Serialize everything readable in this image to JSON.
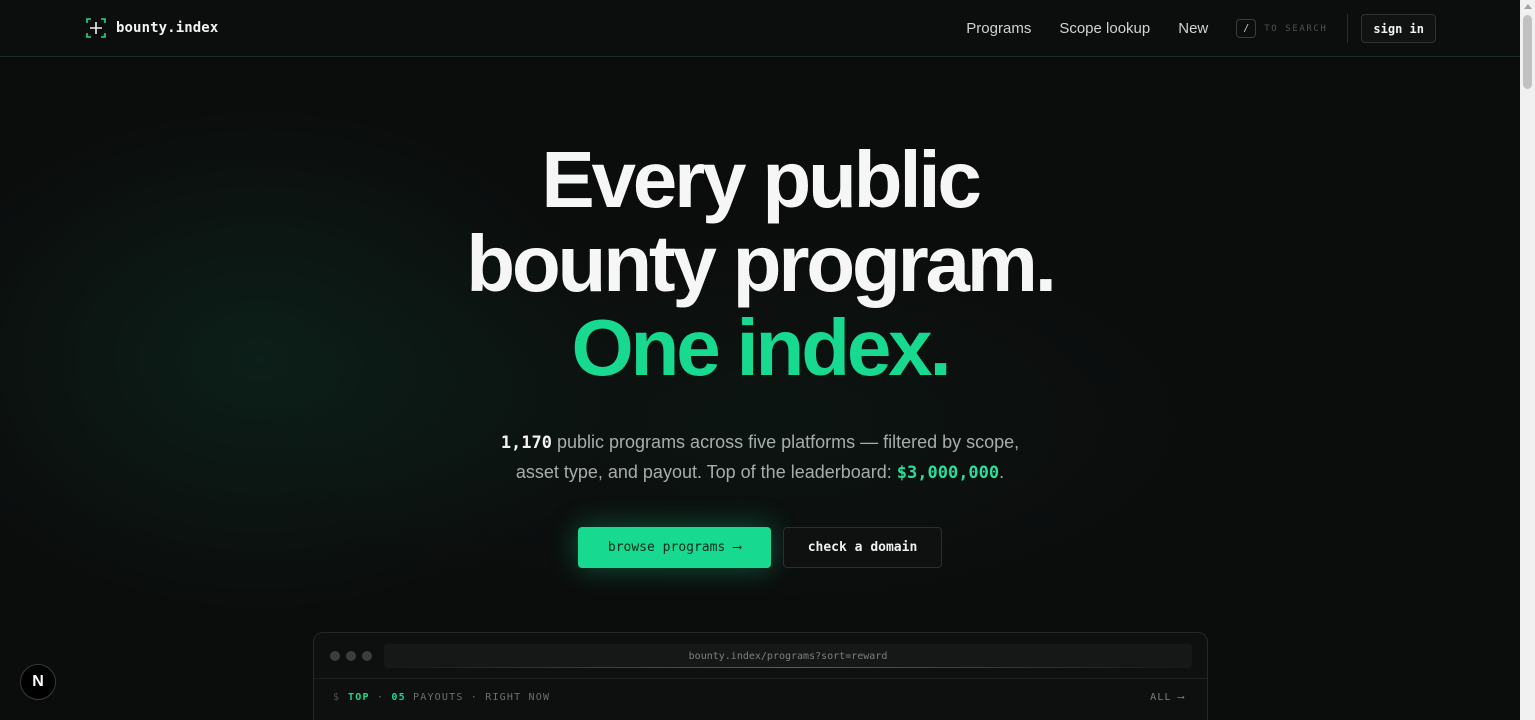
{
  "header": {
    "brand": "bounty.index",
    "nav": [
      "Programs",
      "Scope lookup",
      "New"
    ],
    "search_key": "/",
    "search_hint": "TO SEARCH",
    "signin_label": "sign in"
  },
  "hero": {
    "line1": "Every public",
    "line2": "bounty program.",
    "line3": "One index.",
    "program_count": "1,170",
    "sub_part1": " public programs across five platforms — filtered by scope,",
    "sub_part2": "asset type, and payout. Top of the leaderboard: ",
    "top_payout": "$3,000,000",
    "sub_end": "."
  },
  "cta": {
    "primary_label": "browse programs",
    "primary_arrow": "⟶",
    "secondary_label": "check a domain"
  },
  "window": {
    "url": "bounty.index/programs?sort=reward",
    "prompt": "$",
    "top": "TOP",
    "sep1": " · ",
    "count": "05",
    "rest": " PAYOUTS · RIGHT NOW",
    "all_label": "ALL",
    "all_arrow": "⟶"
  },
  "badge": {
    "letter": "N"
  },
  "colors": {
    "accent": "#17d98f",
    "background": "#0b0c0c"
  }
}
